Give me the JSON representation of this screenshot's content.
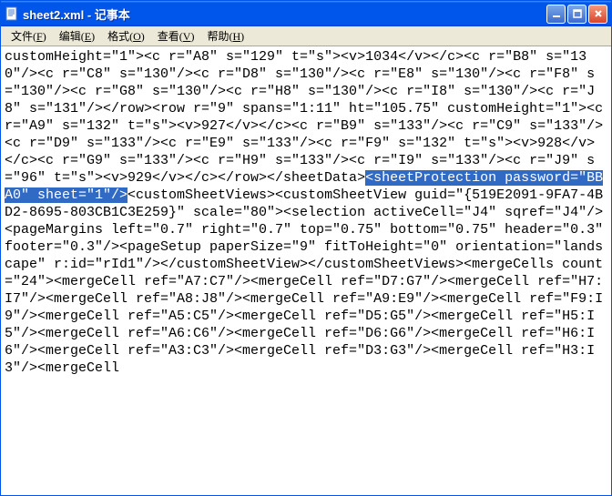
{
  "window": {
    "title": "sheet2.xml - 记事本"
  },
  "menu": {
    "file": "文件",
    "file_key": "F",
    "edit": "编辑",
    "edit_key": "E",
    "format": "格式",
    "format_key": "O",
    "view": "查看",
    "view_key": "V",
    "help": "帮助",
    "help_key": "H"
  },
  "content": {
    "part1": "customHeight=\"1\"><c r=\"A8\" s=\"129\" t=\"s\"><v>1034</v></c><c r=\"B8\" s=\"130\"/><c r=\"C8\" s=\"130\"/><c r=\"D8\" s=\"130\"/><c r=\"E8\" s=\"130\"/><c r=\"F8\" s=\"130\"/><c r=\"G8\" s=\"130\"/><c r=\"H8\" s=\"130\"/><c r=\"I8\" s=\"130\"/><c r=\"J8\" s=\"131\"/></row><row r=\"9\" spans=\"1:11\" ht=\"105.75\" customHeight=\"1\"><c r=\"A9\" s=\"132\" t=\"s\"><v>927</v></c><c r=\"B9\" s=\"133\"/><c r=\"C9\" s=\"133\"/><c r=\"D9\" s=\"133\"/><c r=\"E9\" s=\"133\"/><c r=\"F9\" s=\"132\" t=\"s\"><v>928</v></c><c r=\"G9\" s=\"133\"/><c r=\"H9\" s=\"133\"/><c r=\"I9\" s=\"133\"/><c r=\"J9\" s=\"96\" t=\"s\"><v>929</v></c></row></sheetData>",
    "highlighted": "<sheetProtection password=\"BBA0\" sheet=\"1\"/>",
    "part2": "<customSheetViews><customSheetView guid=\"{519E2091-9FA7-4BD2-8695-803CB1C3E259}\" scale=\"80\"><selection activeCell=\"J4\" sqref=\"J4\"/><pageMargins left=\"0.7\" right=\"0.7\" top=\"0.75\" bottom=\"0.75\" header=\"0.3\" footer=\"0.3\"/><pageSetup paperSize=\"9\" fitToHeight=\"0\" orientation=\"landscape\" r:id=\"rId1\"/></customSheetView></customSheetViews><mergeCells count=\"24\"><mergeCell ref=\"A7:C7\"/><mergeCell ref=\"D7:G7\"/><mergeCell ref=\"H7:I7\"/><mergeCell ref=\"A8:J8\"/><mergeCell ref=\"A9:E9\"/><mergeCell ref=\"F9:I9\"/><mergeCell ref=\"A5:C5\"/><mergeCell ref=\"D5:G5\"/><mergeCell ref=\"H5:I5\"/><mergeCell ref=\"A6:C6\"/><mergeCell ref=\"D6:G6\"/><mergeCell ref=\"H6:I6\"/><mergeCell ref=\"A3:C3\"/><mergeCell ref=\"D3:G3\"/><mergeCell ref=\"H3:I3\"/><mergeCell"
  }
}
